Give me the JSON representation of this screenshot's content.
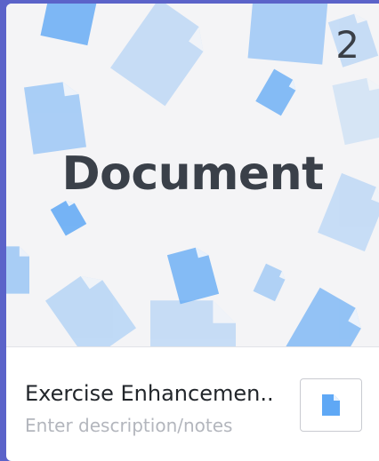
{
  "card": {
    "page_count": "2",
    "thumbnail_title": "Document",
    "name": "Exercise Enhancemen..",
    "notes_placeholder": "Enter description/notes"
  },
  "icons": {
    "thumbnail_pattern": "document-icon",
    "type_button": "document-icon"
  },
  "colors": {
    "accent": "#5fa8f5",
    "accent_light": "#bcdcfb",
    "background": "#5b63c9"
  }
}
